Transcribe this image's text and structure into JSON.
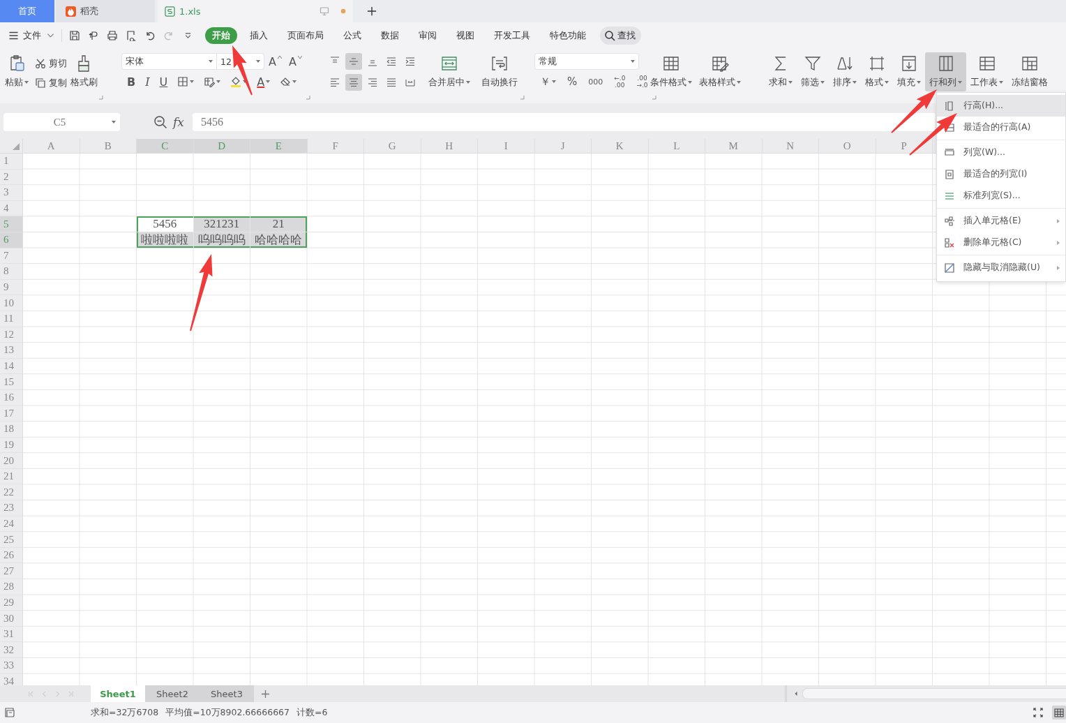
{
  "title_tabs": [
    {
      "label": "首页",
      "kind": "home",
      "selected": false,
      "unsaved": false
    },
    {
      "label": "稻壳",
      "kind": "docer",
      "selected": false,
      "unsaved": false
    },
    {
      "label": "1.xls",
      "kind": "sheet",
      "selected": true,
      "unsaved": true
    }
  ],
  "menu": {
    "file": "文件",
    "tabs": [
      {
        "label": "开始",
        "selected": true
      },
      {
        "label": "插入",
        "selected": false
      },
      {
        "label": "页面布局",
        "selected": false
      },
      {
        "label": "公式",
        "selected": false
      },
      {
        "label": "数据",
        "selected": false
      },
      {
        "label": "审阅",
        "selected": false
      },
      {
        "label": "视图",
        "selected": false
      },
      {
        "label": "开发工具",
        "selected": false
      },
      {
        "label": "特色功能",
        "selected": false
      }
    ],
    "search": "查找"
  },
  "ribbon": {
    "paste": "粘贴",
    "cut": "剪切",
    "copy": "复制",
    "format_painter": "格式刷",
    "font_name": "宋体",
    "font_size": "12",
    "grow_font": "A",
    "shrink_font": "A",
    "bold": "B",
    "italic": "I",
    "underline": "U",
    "font_color": "A",
    "alignment_top_row": [
      {
        "kind": "top",
        "selected": false
      },
      {
        "kind": "middle",
        "selected": true
      },
      {
        "kind": "bottom",
        "selected": false
      },
      {
        "kind": "outdent",
        "selected": false
      },
      {
        "kind": "indent",
        "selected": false
      }
    ],
    "alignment_bottom_row": [
      {
        "kind": "left",
        "selected": false
      },
      {
        "kind": "center",
        "selected": true
      },
      {
        "kind": "right",
        "selected": false
      },
      {
        "kind": "justify",
        "selected": false
      },
      {
        "kind": "distributed",
        "selected": false
      }
    ],
    "align_tools": [
      {
        "label": "合并居中",
        "kind": "merge",
        "dropdown": true
      },
      {
        "label": "自动换行",
        "kind": "wrap",
        "dropdown": false
      }
    ],
    "number_format": "常规",
    "currency": "￥",
    "percent": "%",
    "thousands": "000",
    "decimal_more": [
      "←.0",
      ".00"
    ],
    "decimal_less": [
      ".00",
      "→.0"
    ],
    "styles": [
      {
        "label": "条件格式",
        "kind": "conditional",
        "dropdown": true
      },
      {
        "label": "表格样式",
        "kind": "table-style",
        "dropdown": true
      }
    ],
    "tools": [
      {
        "label": "求和",
        "kind": "sum",
        "dropdown": true,
        "expanded": false
      },
      {
        "label": "筛选",
        "kind": "filter",
        "dropdown": true,
        "expanded": false
      },
      {
        "label": "排序",
        "kind": "sort",
        "dropdown": true,
        "expanded": false
      },
      {
        "label": "格式",
        "kind": "format",
        "dropdown": true,
        "expanded": false
      },
      {
        "label": "填充",
        "kind": "fill",
        "dropdown": true,
        "expanded": false
      },
      {
        "label": "行和列",
        "kind": "rows-columns",
        "dropdown": true,
        "expanded": true
      },
      {
        "label": "工作表",
        "kind": "worksheet",
        "dropdown": true,
        "expanded": false
      },
      {
        "label": "冻结窗格",
        "kind": "freeze",
        "dropdown": false,
        "expanded": false
      }
    ]
  },
  "formula_bar": {
    "name_box": "C5",
    "function_label": "fx",
    "formula": "5456"
  },
  "sheet": {
    "columns": [
      {
        "label": "A",
        "selected": false
      },
      {
        "label": "B",
        "selected": false
      },
      {
        "label": "C",
        "selected": true
      },
      {
        "label": "D",
        "selected": true
      },
      {
        "label": "E",
        "selected": true
      },
      {
        "label": "F",
        "selected": false
      },
      {
        "label": "G",
        "selected": false
      },
      {
        "label": "H",
        "selected": false
      },
      {
        "label": "I",
        "selected": false
      },
      {
        "label": "J",
        "selected": false
      },
      {
        "label": "K",
        "selected": false
      },
      {
        "label": "L",
        "selected": false
      },
      {
        "label": "M",
        "selected": false
      },
      {
        "label": "N",
        "selected": false
      },
      {
        "label": "O",
        "selected": false
      },
      {
        "label": "P",
        "selected": false
      }
    ],
    "rows": [
      {
        "label": "1",
        "selected": false
      },
      {
        "label": "2",
        "selected": false
      },
      {
        "label": "3",
        "selected": false
      },
      {
        "label": "4",
        "selected": false
      },
      {
        "label": "5",
        "selected": true,
        "cells": [
          null,
          null,
          {
            "value": "5456",
            "active": true
          },
          {
            "value": "321231",
            "active": false
          },
          {
            "value": "21",
            "active": false
          }
        ]
      },
      {
        "label": "6",
        "selected": true,
        "cells": [
          null,
          null,
          {
            "value": "啦啦啦啦",
            "active": false
          },
          {
            "value": "呜呜呜呜",
            "active": false
          },
          {
            "value": "哈哈哈哈",
            "active": false
          }
        ]
      },
      {
        "label": "7",
        "selected": false
      },
      {
        "label": "8",
        "selected": false
      },
      {
        "label": "9",
        "selected": false
      },
      {
        "label": "10",
        "selected": false
      },
      {
        "label": "11",
        "selected": false
      },
      {
        "label": "12",
        "selected": false
      },
      {
        "label": "13",
        "selected": false
      },
      {
        "label": "14",
        "selected": false
      },
      {
        "label": "15",
        "selected": false
      },
      {
        "label": "16",
        "selected": false
      },
      {
        "label": "17",
        "selected": false
      },
      {
        "label": "18",
        "selected": false
      },
      {
        "label": "19",
        "selected": false
      },
      {
        "label": "20",
        "selected": false
      },
      {
        "label": "21",
        "selected": false
      },
      {
        "label": "22",
        "selected": false
      },
      {
        "label": "23",
        "selected": false
      },
      {
        "label": "24",
        "selected": false
      },
      {
        "label": "25",
        "selected": false
      },
      {
        "label": "26",
        "selected": false
      },
      {
        "label": "27",
        "selected": false
      },
      {
        "label": "28",
        "selected": false
      },
      {
        "label": "29",
        "selected": false
      },
      {
        "label": "30",
        "selected": false
      },
      {
        "label": "31",
        "selected": false
      },
      {
        "label": "32",
        "selected": false
      },
      {
        "label": "33",
        "selected": false
      },
      {
        "label": "34",
        "selected": false
      }
    ]
  },
  "context_menu": {
    "groups": [
      {
        "items": [
          {
            "label": "行高(H)...",
            "kind": "row-height",
            "selected": true,
            "submenu": false
          },
          {
            "label": "最适合的行高(A)",
            "kind": "autofit-row",
            "selected": false,
            "submenu": false
          }
        ]
      },
      {
        "items": [
          {
            "label": "列宽(W)...",
            "kind": "column-width",
            "selected": false,
            "submenu": false
          },
          {
            "label": "最适合的列宽(I)",
            "kind": "autofit-column",
            "selected": false,
            "submenu": false
          },
          {
            "label": "标准列宽(S)...",
            "kind": "standard-width",
            "selected": false,
            "submenu": false
          }
        ]
      },
      {
        "items": [
          {
            "label": "插入单元格(E)",
            "kind": "insert-cells",
            "selected": false,
            "submenu": true
          },
          {
            "label": "删除单元格(C)",
            "kind": "delete-cells",
            "selected": false,
            "submenu": true
          }
        ]
      },
      {
        "items": [
          {
            "label": "隐藏与取消隐藏(U)",
            "kind": "hide",
            "selected": false,
            "submenu": true
          }
        ]
      }
    ]
  },
  "sheet_tabs": [
    {
      "label": "Sheet1",
      "selected": true
    },
    {
      "label": "Sheet2",
      "selected": false
    },
    {
      "label": "Sheet3",
      "selected": false
    }
  ],
  "status_bar": {
    "items": [
      "求和=32万6708",
      "平均值=10万8902.66666667",
      "计数=6"
    ]
  }
}
